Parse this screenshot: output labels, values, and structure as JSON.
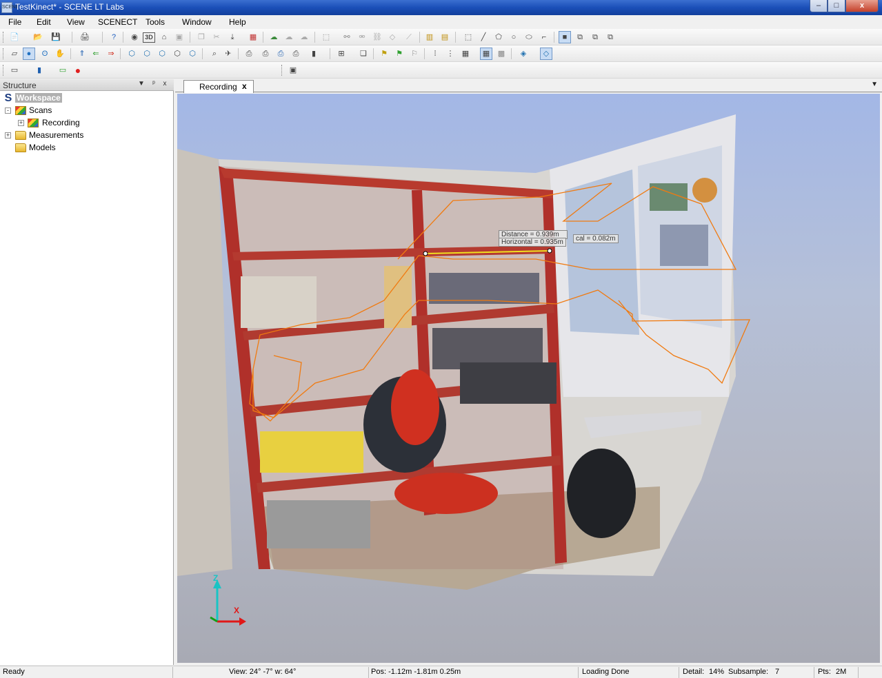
{
  "window": {
    "title": "TestKinect* - SCENE LT Labs",
    "app_icon_text": "SCENE",
    "minimize": "–",
    "maximize": "□",
    "close": "x"
  },
  "menu": [
    "File",
    "Edit",
    "View",
    "SCENECT",
    "Tools",
    "Window",
    "Help"
  ],
  "toolbar": {
    "row1": [
      "new-icon",
      "open-icon",
      "save-icon",
      "print-icon",
      "help-icon",
      "scan-icon",
      "3d-view-icon",
      "home-icon",
      "window-icon",
      "copy-icon",
      "cut-icon",
      "import-icon",
      "calendar-icon",
      "cloud-icon",
      "cloud-upload-icon",
      "cloud-download-icon",
      "transform-icon",
      "link-icon",
      "unlink-icon",
      "chain-icon",
      "measure-icon",
      "ruler-icon",
      "rect-select-icon",
      "line-icon",
      "polygon-icon",
      "circle-icon",
      "ellipse-icon",
      "corner-icon",
      "view-single-icon",
      "view-dual-icon",
      "view-quad-icon",
      "view-tile-icon"
    ],
    "row1_3d_label": "3D",
    "row2": [
      "select-icon",
      "globe-icon",
      "walk-icon",
      "hand-icon",
      "scan-forward-icon",
      "scan-back-icon",
      "scan-next-icon",
      "cube-front-icon",
      "cube-back-icon",
      "cube-left-icon",
      "cube-right-icon",
      "cube-top-icon",
      "zoom-icon",
      "fly-icon",
      "camera-icon",
      "camera-move-icon",
      "camera-save-icon",
      "camera-load-icon",
      "grid-icon",
      "layer-icon",
      "flag-icon",
      "flag-green-icon",
      "flag-remove-icon",
      "density-1-icon",
      "density-2-icon",
      "density-3-icon",
      "density-4-icon",
      "density-5-icon",
      "box-icon",
      "clip-box-icon"
    ],
    "row3": [
      "record-view-icon",
      "film-icon",
      "export-icon",
      "record-icon"
    ]
  },
  "structure": {
    "title": "Structure",
    "pin": "ᵖ",
    "close": "x",
    "dropdown": "▼",
    "items": [
      {
        "label": "Workspace"
      },
      {
        "label": "Scans",
        "expander": "-"
      },
      {
        "label": "Recording",
        "expander": "+"
      },
      {
        "label": "Measurements",
        "expander": "+"
      },
      {
        "label": "Models"
      }
    ]
  },
  "tabs": {
    "active": "Recording",
    "close": "x",
    "menu": "▼"
  },
  "viewport": {
    "measurements": {
      "distance": "Distance = 0.939m",
      "horizontal": "Horizontal = 0.935m",
      "vertical": "cal = 0.082m"
    },
    "axes": {
      "z": "Z",
      "x": "X"
    },
    "colors": {
      "path": "#f07a10",
      "z_axis": "#19c4c4",
      "x_axis": "#e01818",
      "y_axis": "#12a012"
    }
  },
  "status": {
    "ready": "Ready",
    "view": "View: 24° -7° w: 64°",
    "pos": "Pos: -1.12m -1.81m 0.25m",
    "loading": "Loading Done",
    "detail_label": "Detail:",
    "detail_value": "14%",
    "subsample_label": "Subsample:",
    "subsample_value": "7",
    "pts_label": "Pts:",
    "pts_value": "2M"
  }
}
